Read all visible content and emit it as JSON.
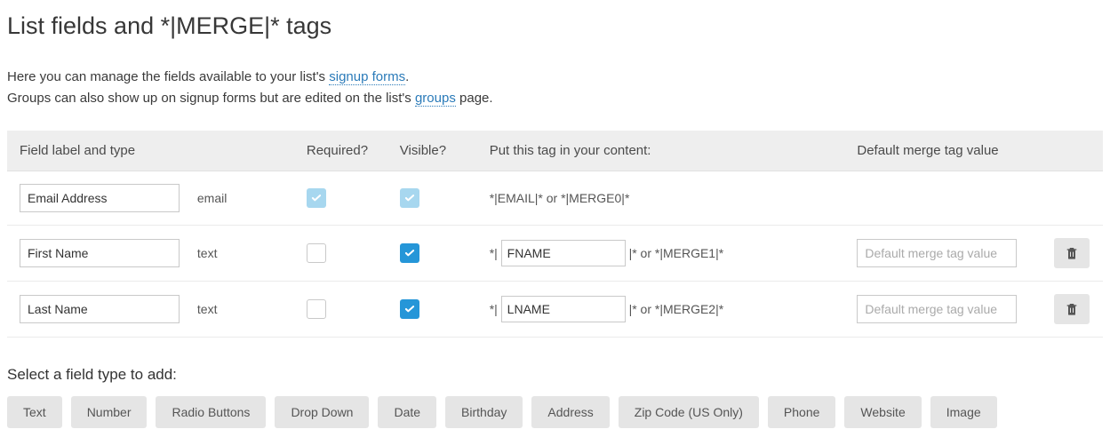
{
  "title": "List fields and *|MERGE|* tags",
  "intro": {
    "line1a": "Here you can manage the fields available to your list's ",
    "signup_link": "signup forms",
    "line1b": ".",
    "line2a": "Groups can also show up on signup forms but are edited on the list's ",
    "groups_link": "groups",
    "line2b": " page."
  },
  "headers": {
    "label": "Field label and type",
    "required": "Required?",
    "visible": "Visible?",
    "tag": "Put this tag in your content:",
    "default": "Default merge tag value"
  },
  "rows": [
    {
      "label": "Email Address",
      "type": "email",
      "required_checked": true,
      "required_locked": true,
      "visible_checked": true,
      "visible_locked": true,
      "tag_text": "*|EMAIL|* or *|MERGE0|*",
      "deletable": false
    },
    {
      "label": "First Name",
      "type": "text",
      "required_checked": false,
      "required_locked": false,
      "visible_checked": true,
      "visible_locked": false,
      "merge_prefix": "*|",
      "merge_value": "FNAME",
      "merge_suffix": "|* or *|MERGE1|*",
      "default_placeholder": "Default merge tag value",
      "default_value": "",
      "deletable": true
    },
    {
      "label": "Last Name",
      "type": "text",
      "required_checked": false,
      "required_locked": false,
      "visible_checked": true,
      "visible_locked": false,
      "merge_prefix": "*|",
      "merge_value": "LNAME",
      "merge_suffix": "|* or *|MERGE2|*",
      "default_placeholder": "Default merge tag value",
      "default_value": "",
      "deletable": true
    }
  ],
  "add_section_title": "Select a field type to add:",
  "type_buttons": [
    "Text",
    "Number",
    "Radio Buttons",
    "Drop Down",
    "Date",
    "Birthday",
    "Address",
    "Zip Code (US Only)",
    "Phone",
    "Website",
    "Image"
  ]
}
